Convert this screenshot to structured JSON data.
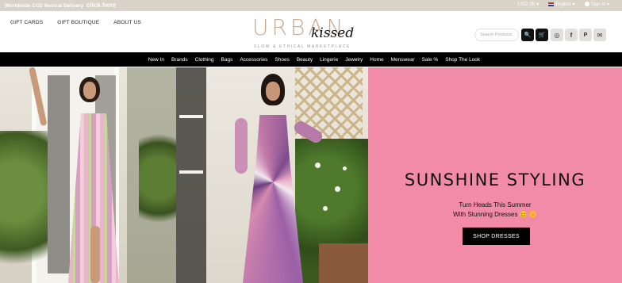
{
  "topbar": {
    "promo": "Worldwide CO2 Neutral Delivery",
    "promo_link": "click here",
    "currency": "USD ($)",
    "language": "English",
    "signin": "Sign In"
  },
  "header": {
    "links": [
      "GIFT CARDS",
      "GIFT BOUTIQUE",
      "ABOUT US"
    ],
    "logo_main": "URBAN",
    "logo_script": "kissed",
    "logo_tagline": "SLOW & ETHICAL MARKETPLACE",
    "search_placeholder": "Search Products"
  },
  "icons": {
    "search": "🔍",
    "cart": "🛒",
    "instagram": "◎",
    "facebook": "f",
    "pinterest": "P",
    "mail": "✉"
  },
  "nav": [
    "New In",
    "Brands",
    "Clothing",
    "Bags",
    "Accessories",
    "Shoes",
    "Beauty",
    "Lingerie",
    "Jewelry",
    "Home",
    "Menswear",
    "Sale %",
    "Shop The Look"
  ],
  "hero": {
    "title": "SUNSHINE STYLING",
    "subtitle_1": "Turn Heads This Summer",
    "subtitle_2": "With Stunning Dresses 😊 🌼",
    "cta": "SHOP DRESSES"
  }
}
